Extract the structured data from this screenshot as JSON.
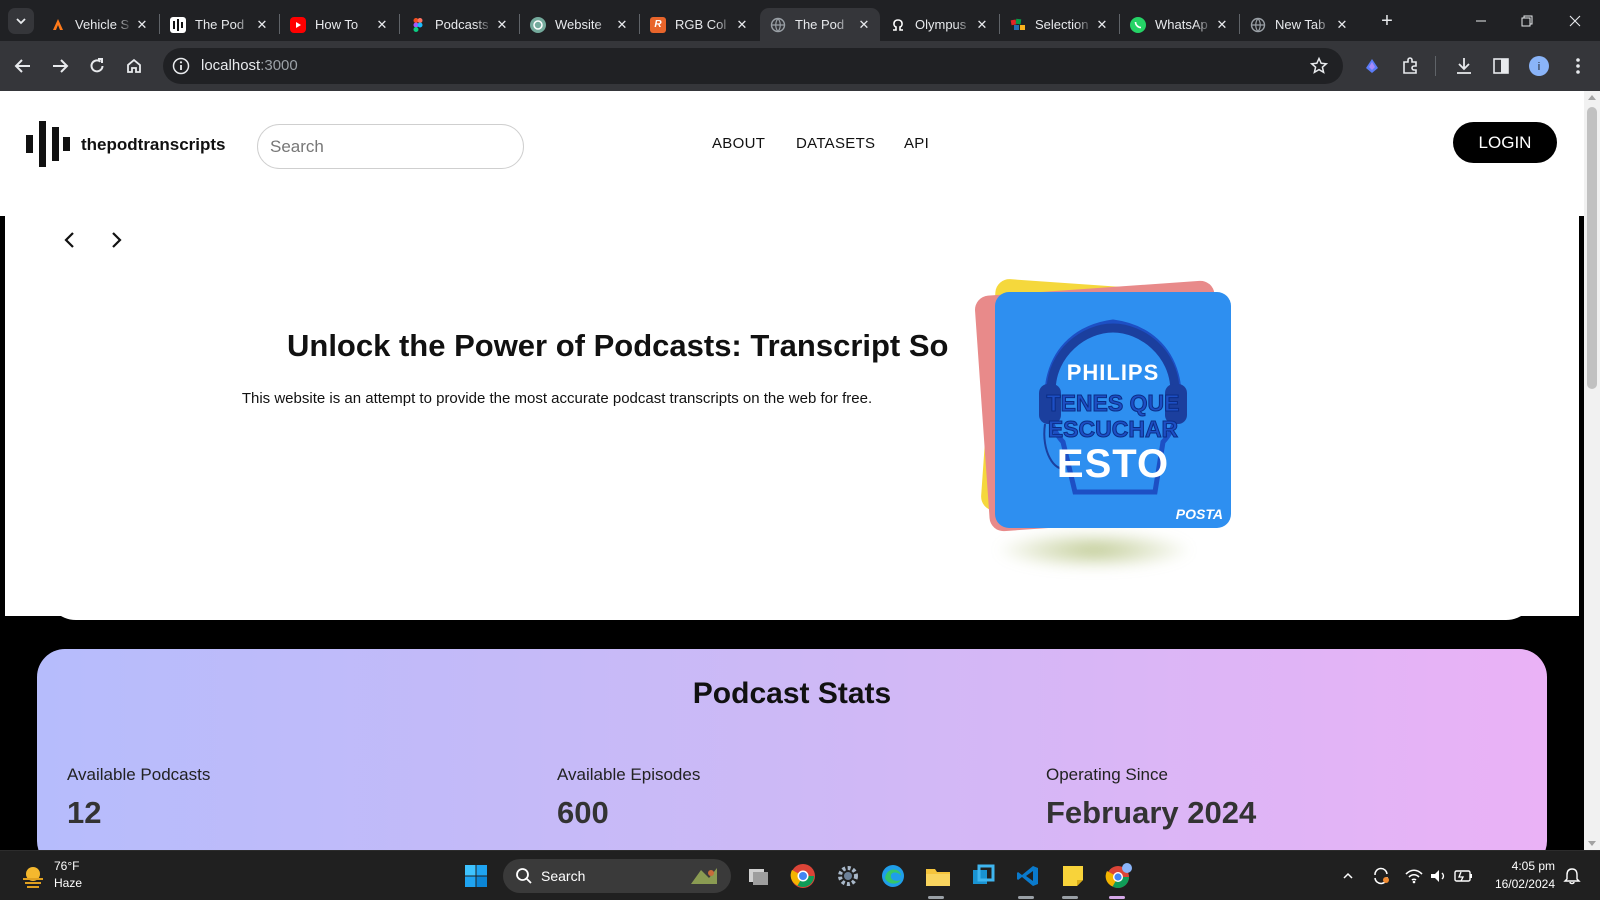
{
  "browser": {
    "tabs": [
      {
        "title": "Vehicle S",
        "favicon": "vehicle-icon",
        "color": "#ff7a1a"
      },
      {
        "title": "The Pod",
        "favicon": "waveform-icon",
        "color": "#ffffff"
      },
      {
        "title": "How To",
        "favicon": "youtube-icon",
        "color": "#ff0000"
      },
      {
        "title": "Podcasts",
        "favicon": "figma-icon",
        "color": "#a259ff"
      },
      {
        "title": "Website",
        "favicon": "openai-icon",
        "color": "#74aa9c"
      },
      {
        "title": "RGB Col",
        "favicon": "rgb-r-icon",
        "color": "#e8652b"
      },
      {
        "title": "The Pod",
        "favicon": "globe-icon",
        "color": "#9aa0a6"
      },
      {
        "title": "Olympus",
        "favicon": "olympus-icon",
        "color": "#ffffff"
      },
      {
        "title": "Selection",
        "favicon": "zoho-icon",
        "color": "#e42527"
      },
      {
        "title": "WhatsAp",
        "favicon": "whatsapp-icon",
        "color": "#25d366"
      },
      {
        "title": "New Tab",
        "favicon": "globe-icon",
        "color": "#9aa0a6"
      }
    ],
    "active_tab_index": 6,
    "url_host": "localhost",
    "url_port": ":3000"
  },
  "site": {
    "brand": "thepodtranscripts",
    "search_placeholder": "Search",
    "nav": [
      "ABOUT",
      "DATASETS",
      "API"
    ],
    "login_label": "LOGIN"
  },
  "hero": {
    "title": "Unlock the Power of Podcasts: Transcript So",
    "subtitle": "This website is an attempt to provide the most accurate podcast transcripts on the web for free.",
    "artwork": {
      "brand": "PHILIPS",
      "line1": "TENES QUE",
      "line2": "ESCUCHAR",
      "line3": "ESTO",
      "badge": "POSTA"
    }
  },
  "stats": {
    "title": "Podcast Stats",
    "items": [
      {
        "label": "Available Podcasts",
        "value": "12"
      },
      {
        "label": "Available Episodes",
        "value": "600"
      },
      {
        "label": "Operating Since",
        "value": "February 2024"
      }
    ]
  },
  "taskbar": {
    "weather_temp": "76°F",
    "weather_condition": "Haze",
    "search_label": "Search",
    "time": "4:05 pm",
    "date": "16/02/2024"
  }
}
